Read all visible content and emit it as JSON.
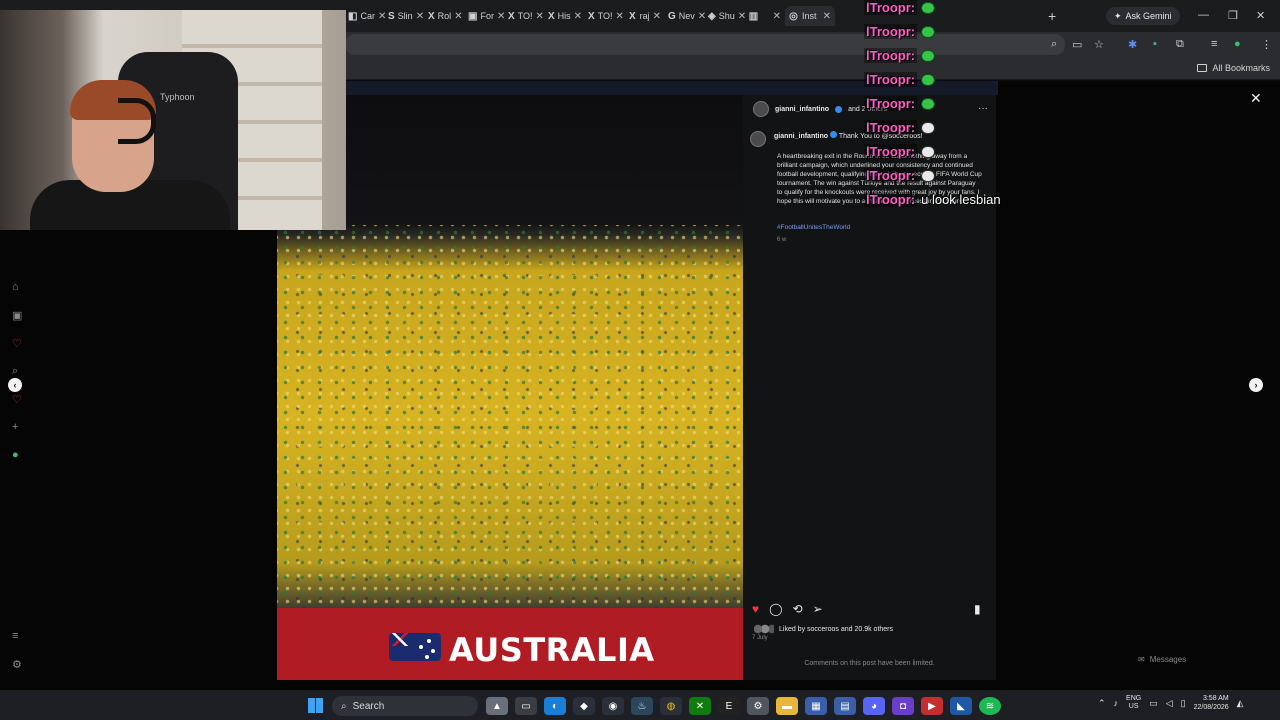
{
  "browser": {
    "tabs": [
      {
        "icon": "tab-favicon",
        "label": "Car",
        "active": false
      },
      {
        "icon": "slime-icon",
        "label": "Slin",
        "active": false
      },
      {
        "icon": "x-icon",
        "label": "Rol",
        "active": false
      },
      {
        "icon": "forum-icon",
        "label": "For",
        "active": false
      },
      {
        "icon": "x-icon",
        "label": "TO!",
        "active": false
      },
      {
        "icon": "x-icon",
        "label": "His",
        "active": false
      },
      {
        "icon": "x-icon",
        "label": "TO!",
        "active": false
      },
      {
        "icon": "x-icon",
        "label": "raj",
        "active": false
      },
      {
        "icon": "news-icon",
        "label": "Nev",
        "active": false
      },
      {
        "icon": "shop-icon",
        "label": "Shu",
        "active": false
      },
      {
        "icon": "twitch-icon",
        "label": "",
        "active": false
      },
      {
        "icon": "instagram-icon",
        "label": "Inst",
        "active": true
      }
    ],
    "tab_icon_glyphs": [
      "◧",
      "S",
      "X",
      "▣",
      "X",
      "X",
      "X",
      "X",
      "G",
      "◈",
      "▥",
      "◎"
    ],
    "gemini_label": "Ask Gemini",
    "all_bookmarks": "All Bookmarks"
  },
  "chat": [
    {
      "user": "lTroopr:",
      "emote": "green",
      "msg": ""
    },
    {
      "user": "lTroopr:",
      "emote": "green",
      "msg": ""
    },
    {
      "user": "lTroopr:",
      "emote": "green",
      "msg": ""
    },
    {
      "user": "lTroopr:",
      "emote": "green",
      "msg": ""
    },
    {
      "user": "lTroopr:",
      "emote": "green",
      "msg": ""
    },
    {
      "user": "lTroopr:",
      "emote": "skull",
      "msg": ""
    },
    {
      "user": "lTroopr:",
      "emote": "skull",
      "msg": ""
    },
    {
      "user": "lTroopr:",
      "emote": "skull",
      "msg": ""
    },
    {
      "user": "lTroopr:",
      "emote": "",
      "msg": "u look lesbian"
    }
  ],
  "webcam": {
    "chair_text": "Typhoon"
  },
  "post": {
    "author": "gianni_infantino",
    "others": "and 2 others",
    "caption_author": "gianni_infantino",
    "caption_start": "Thank You to @socceroos!",
    "caption": "A heartbreaking exit in the Round of 32 takes nothing away from a brilliant campaign, which underlined your consistency and continued football development, qualifying for a sixth consecutive FIFA World Cup tournament. The win against Türkiye and the result against Paraguay to qualify for the knockouts were received with great joy by your fans. I hope this will motivate you to achieve more success in the future.",
    "hashtag": "#FootballUnitesTheWorld",
    "time_ago": "6 w",
    "liked_by": "Liked by socceroos and 20.9k others",
    "date": "7 July",
    "comments_limited": "Comments on this post have been limited.",
    "banner_text": "AUSTRALIA",
    "liked": true
  },
  "messages_label": "Messages",
  "taskbar": {
    "search_placeholder": "Search",
    "lang": "ENG",
    "region": "US",
    "time": "3:58 AM",
    "date": "22/08/2026"
  },
  "colors": {
    "accent": "#ff3040",
    "chat_user": "#ff5fc8",
    "banner": "#b01c24",
    "link": "#7c9ff2"
  }
}
